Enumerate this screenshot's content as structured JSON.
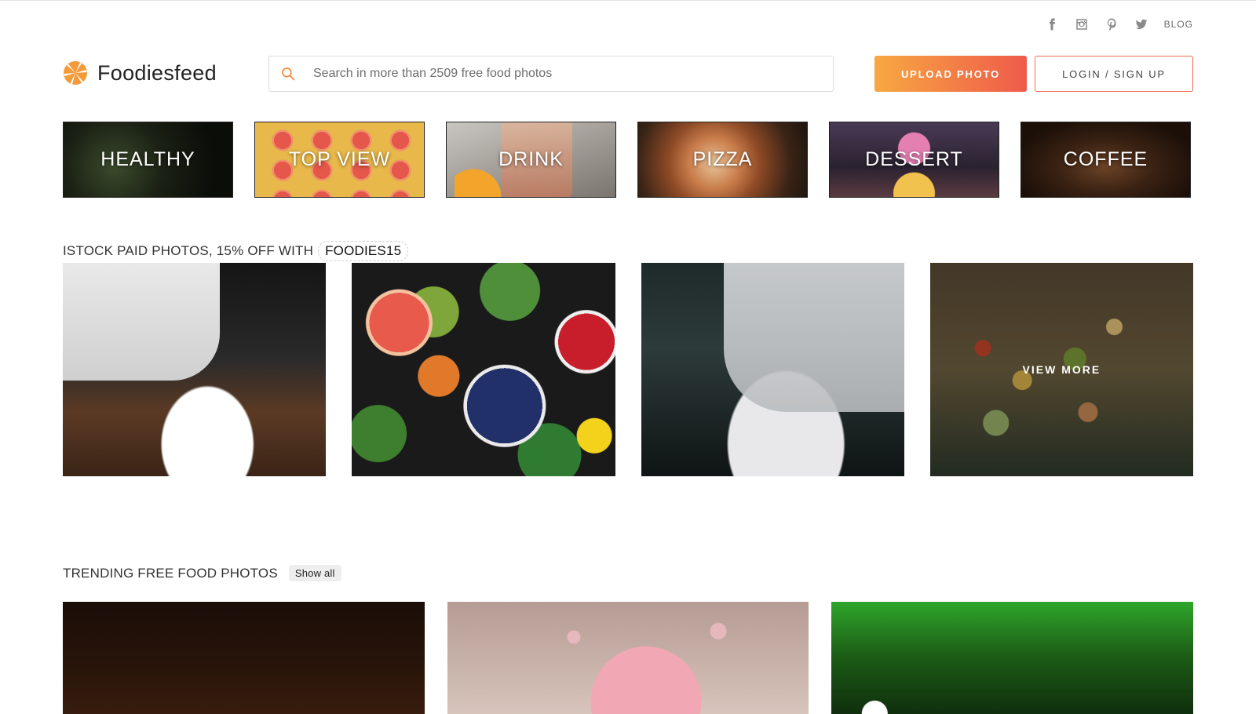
{
  "social": {
    "icons": [
      "facebook-icon",
      "instagram-icon",
      "pinterest-icon",
      "twitter-icon"
    ],
    "blog_label": "BLOG"
  },
  "brand": {
    "name": "Foodiesfeed",
    "accent_orange": "#f7a842",
    "accent_red": "#ef5a4a"
  },
  "search": {
    "placeholder": "Search in more than 2509 free food photos",
    "value": ""
  },
  "header": {
    "upload_label": "UPLOAD PHOTO",
    "login_label": "LOGIN / SIGN UP"
  },
  "categories": [
    {
      "label": "HEALTHY"
    },
    {
      "label": "TOP VIEW"
    },
    {
      "label": "DRINK"
    },
    {
      "label": "PIZZA"
    },
    {
      "label": "DESSERT"
    },
    {
      "label": "COFFEE"
    }
  ],
  "istock": {
    "title": "ISTOCK PAID PHOTOS, 15% OFF WITH",
    "code": "FOODIES15",
    "view_more": "VIEW MORE"
  },
  "trending": {
    "title": "TRENDING FREE FOOD PHOTOS",
    "show_all": "Show all"
  }
}
